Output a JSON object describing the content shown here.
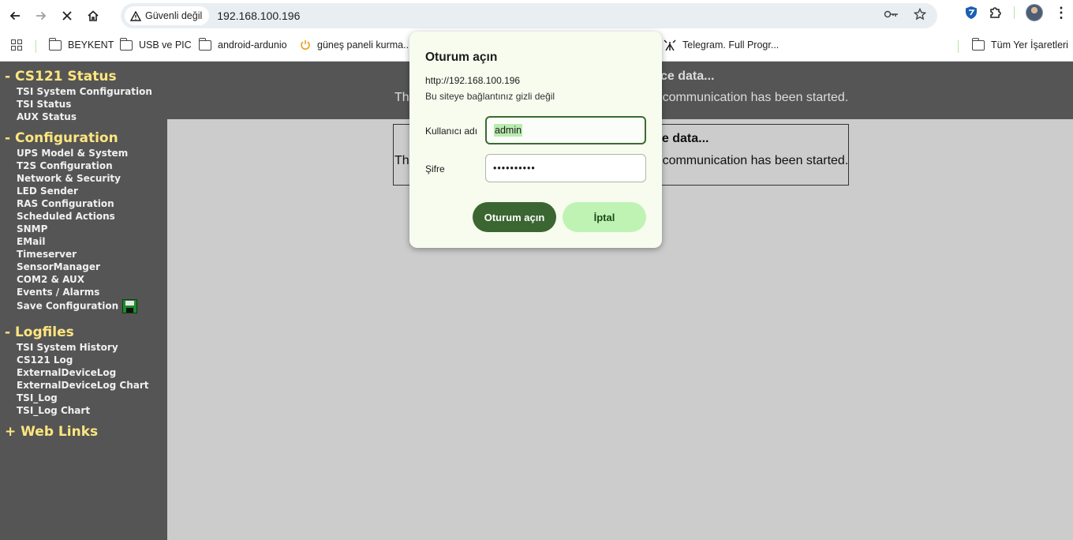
{
  "browser": {
    "security_label": "Güvenli değil",
    "url": "192.168.100.196"
  },
  "bookmarks": [
    {
      "label": "BEYKENT",
      "icon": "folder-icon"
    },
    {
      "label": "USB ve PIC",
      "icon": "folder-icon"
    },
    {
      "label": "android-ardunio",
      "icon": "folder-icon"
    },
    {
      "label": "güneş paneli kurma...",
      "icon": "power-icon"
    },
    {
      "label": "Telegram. Full Progr...",
      "icon": "antenna-icon"
    },
    {
      "label": "Tüm Yer İşaretleri",
      "icon": "folder-icon"
    }
  ],
  "sidebar": {
    "sections": [
      {
        "title": "- CS121 Status",
        "items": [
          "TSI System Configuration",
          "TSI Status",
          "AUX Status"
        ]
      },
      {
        "title": "- Configuration",
        "items": [
          "UPS Model & System",
          "T2S Configuration",
          "Network & Security",
          "LED Sender",
          "RAS Configuration",
          "Scheduled Actions",
          "SNMP",
          "EMail",
          "Timeserver",
          "SensorManager",
          "COM2 & AUX",
          "Events / Alarms",
          "Save Configuration"
        ]
      },
      {
        "title": "- Logfiles",
        "items": [
          "TSI System History",
          "CS121 Log",
          "ExternalDeviceLog",
          "ExternalDeviceLog Chart",
          "TSI_Log",
          "TSI_Log Chart"
        ]
      },
      {
        "title": "+ Web Links",
        "items": []
      }
    ]
  },
  "main": {
    "banner_title_fragment": "ce data...",
    "banner_text_left": "Th",
    "banner_text_right": "communication has been started.",
    "box_title_fragment": "ce data...",
    "box_text_left": "Th",
    "box_text_right": "communication has been started."
  },
  "dialog": {
    "title": "Oturum açın",
    "origin": "http://192.168.100.196",
    "warning": "Bu siteye bağlantınız gizli değil",
    "username_label": "Kullanıcı adı",
    "username_value": "admin",
    "password_label": "Şifre",
    "password_value": "••••••••••",
    "submit_label": "Oturum açın",
    "cancel_label": "İptal"
  },
  "colors": {
    "sidebar_bg": "#555555",
    "heading": "#ffe680",
    "page_bg": "#cccccc",
    "dialog_bg": "#f7fcef",
    "primary_button": "#3b6632",
    "secondary_button": "#bff3b4"
  }
}
